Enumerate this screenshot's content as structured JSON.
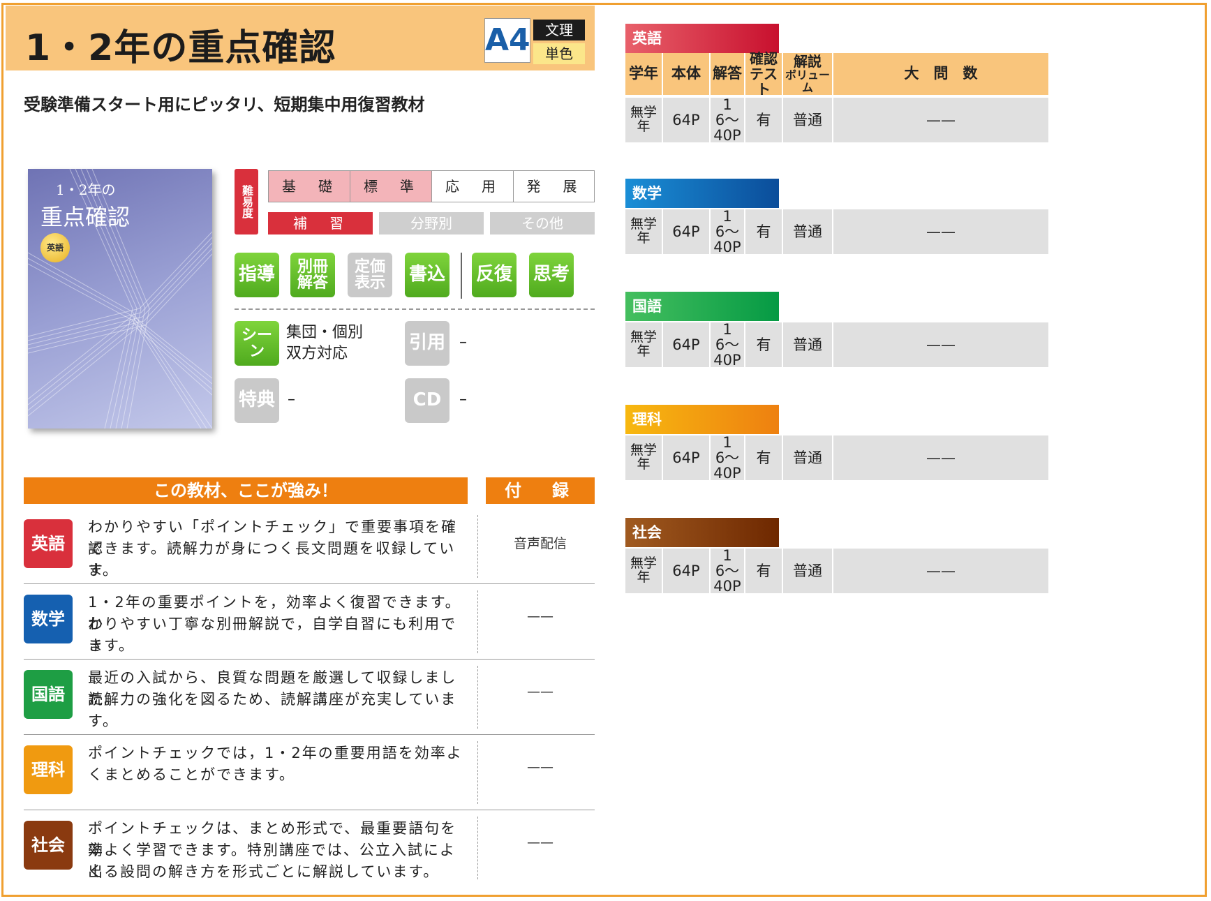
{
  "header": {
    "title": "1・2年の重点確認",
    "size": "A4",
    "tag_bunri": "文理",
    "tag_color": "単色"
  },
  "subtitle": "受験準備スタート用にピッタリ、短期集中用復習教材",
  "cover": {
    "line1": "1・2年の",
    "line2": "重点確認",
    "badge": "英語"
  },
  "difficulty": {
    "label": "難易度",
    "levels": [
      "基　礎",
      "標　準",
      "応　用",
      "発　展"
    ],
    "categories": [
      "補　習",
      "分野別",
      "その他"
    ]
  },
  "features": {
    "badges": [
      "指導",
      "別冊解答",
      "定価表示",
      "書込",
      "反復",
      "思考"
    ],
    "scene_badge": "シーン",
    "scene_text_1": "集団・個別",
    "scene_text_2": "双方対応",
    "quote_badge": "引用",
    "quote_value": "–",
    "tokuten_badge": "特典",
    "tokuten_value": "–",
    "cd_badge": "CD",
    "cd_value": "–"
  },
  "strengths": {
    "heading": "この教材、ここが強み！",
    "furoku_heading": "付　録",
    "rows": [
      {
        "subject": "英語",
        "color": "#d9303c",
        "lines": [
          "わかりやすい「ポイントチェック」で重要事項を確認",
          "できます。読解力が身につく長文問題を収録していま",
          "す。"
        ],
        "furoku": "音声配信"
      },
      {
        "subject": "数学",
        "color": "#1560b0",
        "lines": [
          "1・2年の重要ポイントを，効率よく復習できます。わ",
          "かりやすい丁寧な別冊解説で，自学自習にも利用でき",
          "ます。"
        ],
        "furoku": "——"
      },
      {
        "subject": "国語",
        "color": "#1e9e44",
        "lines": [
          "最近の入試から、良質な問題を厳選して収録しました。",
          "読解力の強化を図るため、読解講座が充実しています。"
        ],
        "furoku": "——"
      },
      {
        "subject": "理科",
        "color": "#f09a10",
        "lines": [
          "ポイントチェックでは，1・2年の重要用語を効率よ",
          "くまとめることができます。"
        ],
        "furoku": "——"
      },
      {
        "subject": "社会",
        "color": "#8a3a10",
        "lines": [
          "ポイントチェックは、まとめ形式で、最重要語句を効",
          "率よく学習できます。特別講座では、公立入試によく",
          "出る設問の解き方を形式ごとに解説しています。"
        ],
        "furoku": "——"
      }
    ]
  },
  "table": {
    "headers": [
      "学年",
      "本体",
      "解答",
      "確認テスト",
      "解説ボリューム",
      "大　問　数"
    ],
    "header_lines": [
      [
        "学年"
      ],
      [
        "本体"
      ],
      [
        "解答"
      ],
      [
        "確認",
        "テスト"
      ],
      [
        "解説",
        "ボリューム"
      ],
      [
        "大　問　数"
      ]
    ],
    "subjects": [
      {
        "name": "英語",
        "color1": "#e8606a",
        "color2": "#c8102e",
        "cells": [
          "無学年",
          "64P",
          "16〜40P",
          "有",
          "普通",
          "——"
        ]
      },
      {
        "name": "数学",
        "color1": "#1a8ed6",
        "color2": "#0b4d9a",
        "cells": [
          "無学年",
          "64P",
          "16〜40P",
          "有",
          "普通",
          "——"
        ]
      },
      {
        "name": "国語",
        "color1": "#45bf5f",
        "color2": "#059a44",
        "cells": [
          "無学年",
          "64P",
          "16〜40P",
          "有",
          "普通",
          "——"
        ]
      },
      {
        "name": "理科",
        "color1": "#f7b810",
        "color2": "#ee8010",
        "cells": [
          "無学年",
          "64P",
          "16〜40P",
          "有",
          "普通",
          "——"
        ]
      },
      {
        "name": "社会",
        "color1": "#a05a20",
        "color2": "#6e2800",
        "cells": [
          "無学年",
          "64P",
          "16〜40P",
          "有",
          "普通",
          "——"
        ]
      }
    ]
  }
}
